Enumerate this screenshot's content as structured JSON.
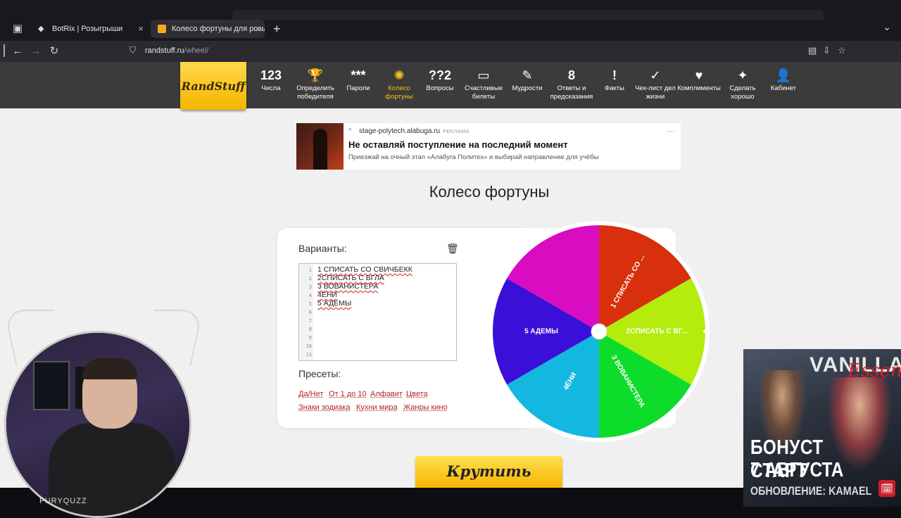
{
  "browser": {
    "tabs": [
      {
        "title": "BotRix | Розыгрыши",
        "icon": "botrix-icon"
      },
      {
        "title": "Колесо фортуны для розыгры",
        "icon": "randstuff-favicon"
      }
    ],
    "url_host": "randstuff.ru",
    "url_path": "/wheel/"
  },
  "site": {
    "logo": "RandStuff",
    "nav": [
      {
        "icon": "123",
        "label": "Числа"
      },
      {
        "icon": "🏆",
        "label": "Определить победителя"
      },
      {
        "icon": "***",
        "label": "Пароли"
      },
      {
        "icon": "✺",
        "label": "Колесо фортуны",
        "active": true
      },
      {
        "icon": "??2",
        "label": "Вопросы"
      },
      {
        "icon": "▭",
        "label": "Счастливые билеты"
      },
      {
        "icon": "✎",
        "label": "Мудрости"
      },
      {
        "icon": "8",
        "label": "Ответы и предсказания"
      },
      {
        "icon": "!",
        "label": "Факты"
      },
      {
        "icon": "✓",
        "label": "Чек-лист дел жизни"
      },
      {
        "icon": "♥",
        "label": "Комплименты"
      },
      {
        "icon": "✦",
        "label": "Сделать хорошо"
      },
      {
        "icon": "👤",
        "label": "Кабинет"
      }
    ],
    "ad": {
      "domain": "stage-polytech.alabuga.ru",
      "tag": "РЕКЛАМА",
      "title": "Не оставляй поступление на последний момент",
      "text": "Приезжай на очный этап «Алабуга Политех» и выбирай направление для учёбы"
    },
    "page_title": "Колесо фортуны",
    "variants_label": "Варианты:",
    "lines": [
      "1 СПИСАТЬ СО СВИЧБЕКК",
      "2СПИСАТЬ С ВГЛА",
      "3 ВОВАНИСТЕРА",
      "4ЁНИ",
      "5  АДЕМЫ",
      "",
      "",
      "",
      "",
      "",
      ""
    ],
    "line_numbers": [
      "1",
      "2",
      "3",
      "4",
      "5",
      "6",
      "7",
      "8",
      "9",
      "10",
      "11"
    ],
    "presets_label": "Пресеты:",
    "presets": [
      "Да/Нет",
      "От 1 до 10",
      "Алфавит",
      "Цвета",
      "Знаки зодиака",
      "Кухни мира",
      "Жанры кино"
    ],
    "wheel": {
      "segments": [
        {
          "label": "1 СПИСАТЬ СО ...",
          "color": "#d8300c"
        },
        {
          "label": "2СПИСАТЬ С ВГ...",
          "color": "#b4ec0e"
        },
        {
          "label": "3 ВОВАНИСТЕРА",
          "color": "#0edc2a"
        },
        {
          "label": "4ЁНИ",
          "color": "#13b7e0"
        },
        {
          "label": "5 АДЕМЫ",
          "color": "#3a10d8"
        },
        {
          "label": "",
          "color": "#d80cc0"
        }
      ]
    },
    "spin_label": "Крутить"
  },
  "stream": {
    "cam_name": "FURYQUZZ",
    "banner": {
      "brand": "VANILLA",
      "brand_script": "Essence",
      "line1": "БОНУСТ СТАРТ",
      "line2": "7 АВГУСТА",
      "line3": "ОБНОВЛЕНИЕ: KAMAEL"
    }
  }
}
